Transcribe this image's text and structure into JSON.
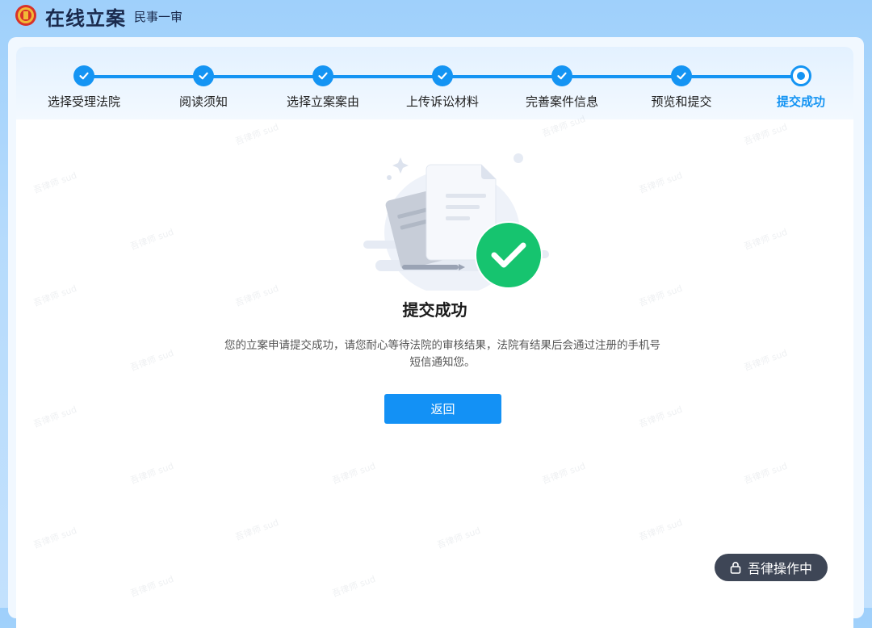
{
  "header": {
    "title": "在线立案",
    "subtitle": "民事一审"
  },
  "steps": [
    {
      "label": "选择受理法院",
      "status": "done"
    },
    {
      "label": "阅读须知",
      "status": "done"
    },
    {
      "label": "选择立案案由",
      "status": "done"
    },
    {
      "label": "上传诉讼材料",
      "status": "done"
    },
    {
      "label": "完善案件信息",
      "status": "done"
    },
    {
      "label": "预览和提交",
      "status": "done"
    },
    {
      "label": "提交成功",
      "status": "current"
    }
  ],
  "result": {
    "title": "提交成功",
    "message": "您的立案申请提交成功，请您耐心等待法院的审核结果，法院有结果后会通过注册的手机号短信通知您。",
    "back_label": "返回"
  },
  "assistant": {
    "label": "吾律操作中",
    "icon": "lock-icon"
  },
  "watermark_text": "吾律师 sud",
  "colors": {
    "accent": "#1494f3",
    "success": "#16c46f",
    "assistant_bg": "#3e4656"
  }
}
